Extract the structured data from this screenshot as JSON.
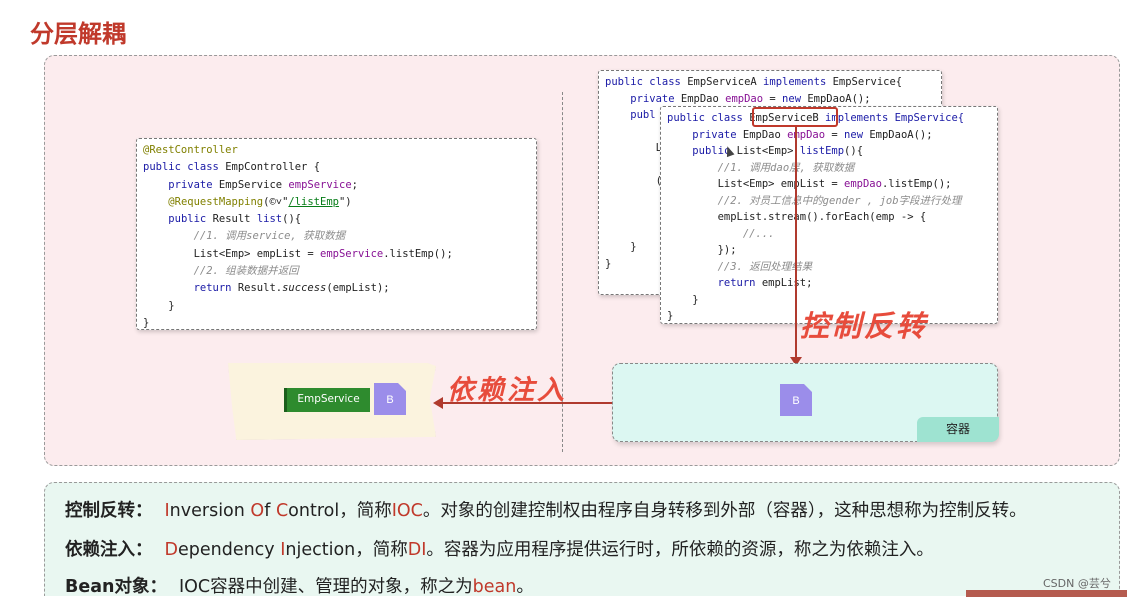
{
  "title": "分层解耦",
  "controller_code": [
    "@RestController",
    "public class EmpController {",
    "    private EmpService empService;",
    "    @RequestMapping(©˅\"/listEmp\")",
    "    public Result list(){",
    "        //1. 调用service, 获取数据",
    "        List<Emp> empList = empService.listEmp();",
    "        //2. 组装数据并返回",
    "        return Result.success(empList);",
    "    }",
    "}"
  ],
  "service_a_code": [
    "public class EmpServiceA implements EmpService{",
    "    private EmpDao empDao = new EmpDaoA();",
    "    publ",
    "",
    "        L",
    "",
    "        (",
    "",
    "",
    "",
    "    }",
    "}"
  ],
  "service_b_code": {
    "line1_prefix": "public class ",
    "line1_class": "EmpServiceB",
    "line1_suffix": " implements EmpService{",
    "lines": [
      "    private EmpDao empDao = new EmpDaoA();",
      "    public List<Emp> listEmp(){",
      "        //1. 调用dao层, 获取数据",
      "        List<Emp> empList = empDao.listEmp();",
      "        //2. 对员工信息中的gender , job字段进行处理",
      "        empList.stream().forEach(emp -> {",
      "            //...",
      "        });",
      "        //3. 返回处理结果",
      "        return empList;",
      "    }",
      "}"
    ]
  },
  "labels": {
    "ioc": "控制反转",
    "di": "依赖注入",
    "container": "容器",
    "emp_service": "EmpService",
    "bean_b_1": "B",
    "bean_b_2": "B"
  },
  "definitions": {
    "ioc": {
      "term": "控制反转：",
      "pre": "",
      "i": "I",
      "t1": "nversion ",
      "o": "O",
      "t2": "f ",
      "c": "C",
      "t3": "ontrol，简称",
      "abbr": "IOC",
      "rest": "。对象的创建控制权由程序自身转移到外部（容器），这种思想称为控制反转。"
    },
    "di": {
      "term": "依赖注入：",
      "d": "D",
      "t1": "ependency ",
      "i": "I",
      "t2": "njection，简称",
      "abbr": "DI",
      "rest": "。容器为应用程序提供运行时，所依赖的资源，称之为依赖注入。"
    },
    "bean": {
      "term": "Bean对象：",
      "text": "IOC容器中创建、管理的对象，称之为",
      "bean": "bean",
      "end": "。"
    }
  },
  "watermark": "CSDN @芸兮",
  "colors": {
    "accent_red": "#c0392b",
    "main_panel_bg": "#fcecee",
    "definition_panel_bg": "#e9f7f1",
    "container_bg": "#dcf7f2",
    "bean_color": "#9b8dea",
    "emp_service_green": "#2e8b2e"
  }
}
